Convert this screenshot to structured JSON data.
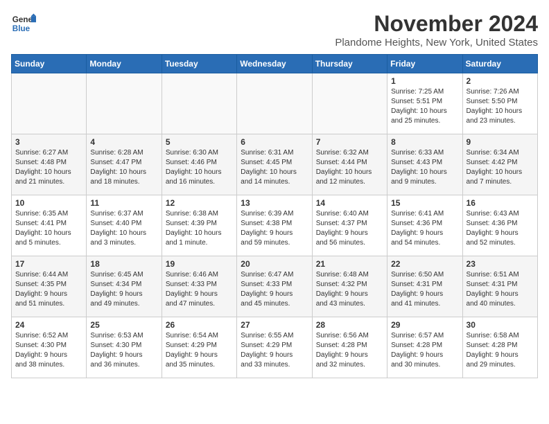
{
  "logo": {
    "line1": "General",
    "line2": "Blue"
  },
  "title": "November 2024",
  "location": "Plandome Heights, New York, United States",
  "days_header": [
    "Sunday",
    "Monday",
    "Tuesday",
    "Wednesday",
    "Thursday",
    "Friday",
    "Saturday"
  ],
  "weeks": [
    [
      {
        "day": "",
        "info": ""
      },
      {
        "day": "",
        "info": ""
      },
      {
        "day": "",
        "info": ""
      },
      {
        "day": "",
        "info": ""
      },
      {
        "day": "",
        "info": ""
      },
      {
        "day": "1",
        "info": "Sunrise: 7:25 AM\nSunset: 5:51 PM\nDaylight: 10 hours\nand 25 minutes."
      },
      {
        "day": "2",
        "info": "Sunrise: 7:26 AM\nSunset: 5:50 PM\nDaylight: 10 hours\nand 23 minutes."
      }
    ],
    [
      {
        "day": "3",
        "info": "Sunrise: 6:27 AM\nSunset: 4:48 PM\nDaylight: 10 hours\nand 21 minutes."
      },
      {
        "day": "4",
        "info": "Sunrise: 6:28 AM\nSunset: 4:47 PM\nDaylight: 10 hours\nand 18 minutes."
      },
      {
        "day": "5",
        "info": "Sunrise: 6:30 AM\nSunset: 4:46 PM\nDaylight: 10 hours\nand 16 minutes."
      },
      {
        "day": "6",
        "info": "Sunrise: 6:31 AM\nSunset: 4:45 PM\nDaylight: 10 hours\nand 14 minutes."
      },
      {
        "day": "7",
        "info": "Sunrise: 6:32 AM\nSunset: 4:44 PM\nDaylight: 10 hours\nand 12 minutes."
      },
      {
        "day": "8",
        "info": "Sunrise: 6:33 AM\nSunset: 4:43 PM\nDaylight: 10 hours\nand 9 minutes."
      },
      {
        "day": "9",
        "info": "Sunrise: 6:34 AM\nSunset: 4:42 PM\nDaylight: 10 hours\nand 7 minutes."
      }
    ],
    [
      {
        "day": "10",
        "info": "Sunrise: 6:35 AM\nSunset: 4:41 PM\nDaylight: 10 hours\nand 5 minutes."
      },
      {
        "day": "11",
        "info": "Sunrise: 6:37 AM\nSunset: 4:40 PM\nDaylight: 10 hours\nand 3 minutes."
      },
      {
        "day": "12",
        "info": "Sunrise: 6:38 AM\nSunset: 4:39 PM\nDaylight: 10 hours\nand 1 minute."
      },
      {
        "day": "13",
        "info": "Sunrise: 6:39 AM\nSunset: 4:38 PM\nDaylight: 9 hours\nand 59 minutes."
      },
      {
        "day": "14",
        "info": "Sunrise: 6:40 AM\nSunset: 4:37 PM\nDaylight: 9 hours\nand 56 minutes."
      },
      {
        "day": "15",
        "info": "Sunrise: 6:41 AM\nSunset: 4:36 PM\nDaylight: 9 hours\nand 54 minutes."
      },
      {
        "day": "16",
        "info": "Sunrise: 6:43 AM\nSunset: 4:36 PM\nDaylight: 9 hours\nand 52 minutes."
      }
    ],
    [
      {
        "day": "17",
        "info": "Sunrise: 6:44 AM\nSunset: 4:35 PM\nDaylight: 9 hours\nand 51 minutes."
      },
      {
        "day": "18",
        "info": "Sunrise: 6:45 AM\nSunset: 4:34 PM\nDaylight: 9 hours\nand 49 minutes."
      },
      {
        "day": "19",
        "info": "Sunrise: 6:46 AM\nSunset: 4:33 PM\nDaylight: 9 hours\nand 47 minutes."
      },
      {
        "day": "20",
        "info": "Sunrise: 6:47 AM\nSunset: 4:33 PM\nDaylight: 9 hours\nand 45 minutes."
      },
      {
        "day": "21",
        "info": "Sunrise: 6:48 AM\nSunset: 4:32 PM\nDaylight: 9 hours\nand 43 minutes."
      },
      {
        "day": "22",
        "info": "Sunrise: 6:50 AM\nSunset: 4:31 PM\nDaylight: 9 hours\nand 41 minutes."
      },
      {
        "day": "23",
        "info": "Sunrise: 6:51 AM\nSunset: 4:31 PM\nDaylight: 9 hours\nand 40 minutes."
      }
    ],
    [
      {
        "day": "24",
        "info": "Sunrise: 6:52 AM\nSunset: 4:30 PM\nDaylight: 9 hours\nand 38 minutes."
      },
      {
        "day": "25",
        "info": "Sunrise: 6:53 AM\nSunset: 4:30 PM\nDaylight: 9 hours\nand 36 minutes."
      },
      {
        "day": "26",
        "info": "Sunrise: 6:54 AM\nSunset: 4:29 PM\nDaylight: 9 hours\nand 35 minutes."
      },
      {
        "day": "27",
        "info": "Sunrise: 6:55 AM\nSunset: 4:29 PM\nDaylight: 9 hours\nand 33 minutes."
      },
      {
        "day": "28",
        "info": "Sunrise: 6:56 AM\nSunset: 4:28 PM\nDaylight: 9 hours\nand 32 minutes."
      },
      {
        "day": "29",
        "info": "Sunrise: 6:57 AM\nSunset: 4:28 PM\nDaylight: 9 hours\nand 30 minutes."
      },
      {
        "day": "30",
        "info": "Sunrise: 6:58 AM\nSunset: 4:28 PM\nDaylight: 9 hours\nand 29 minutes."
      }
    ]
  ]
}
